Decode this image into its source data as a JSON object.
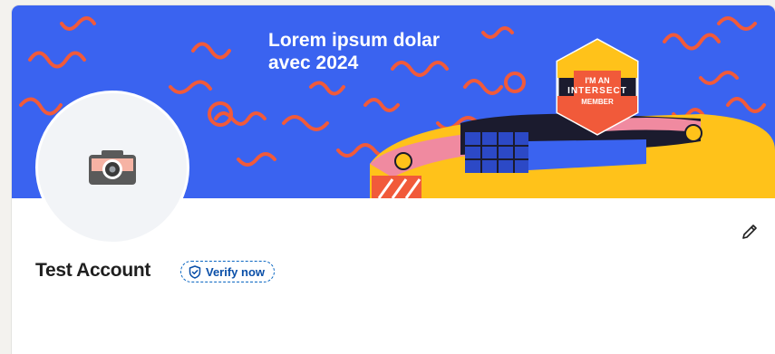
{
  "banner": {
    "title": "Lorem ipsum dolar\navec 2024",
    "badge": {
      "line1": "I'M AN",
      "line2": "INTERSECT",
      "line3": "MEMBER"
    },
    "colors": {
      "background": "#3a63f0",
      "squiggle": "#f15a3a",
      "stage": "#ffc21a",
      "stage_pink": "#f08aa0"
    }
  },
  "avatar": {
    "icon": "camera-icon"
  },
  "actions": {
    "edit_icon": "pencil-icon"
  },
  "profile": {
    "name": "Test Account",
    "verify_label": "Verify now",
    "verify_icon": "shield-check-icon"
  },
  "colors": {
    "accent": "#0a66c2",
    "card": "#ffffff",
    "page": "#f3f2ee"
  }
}
